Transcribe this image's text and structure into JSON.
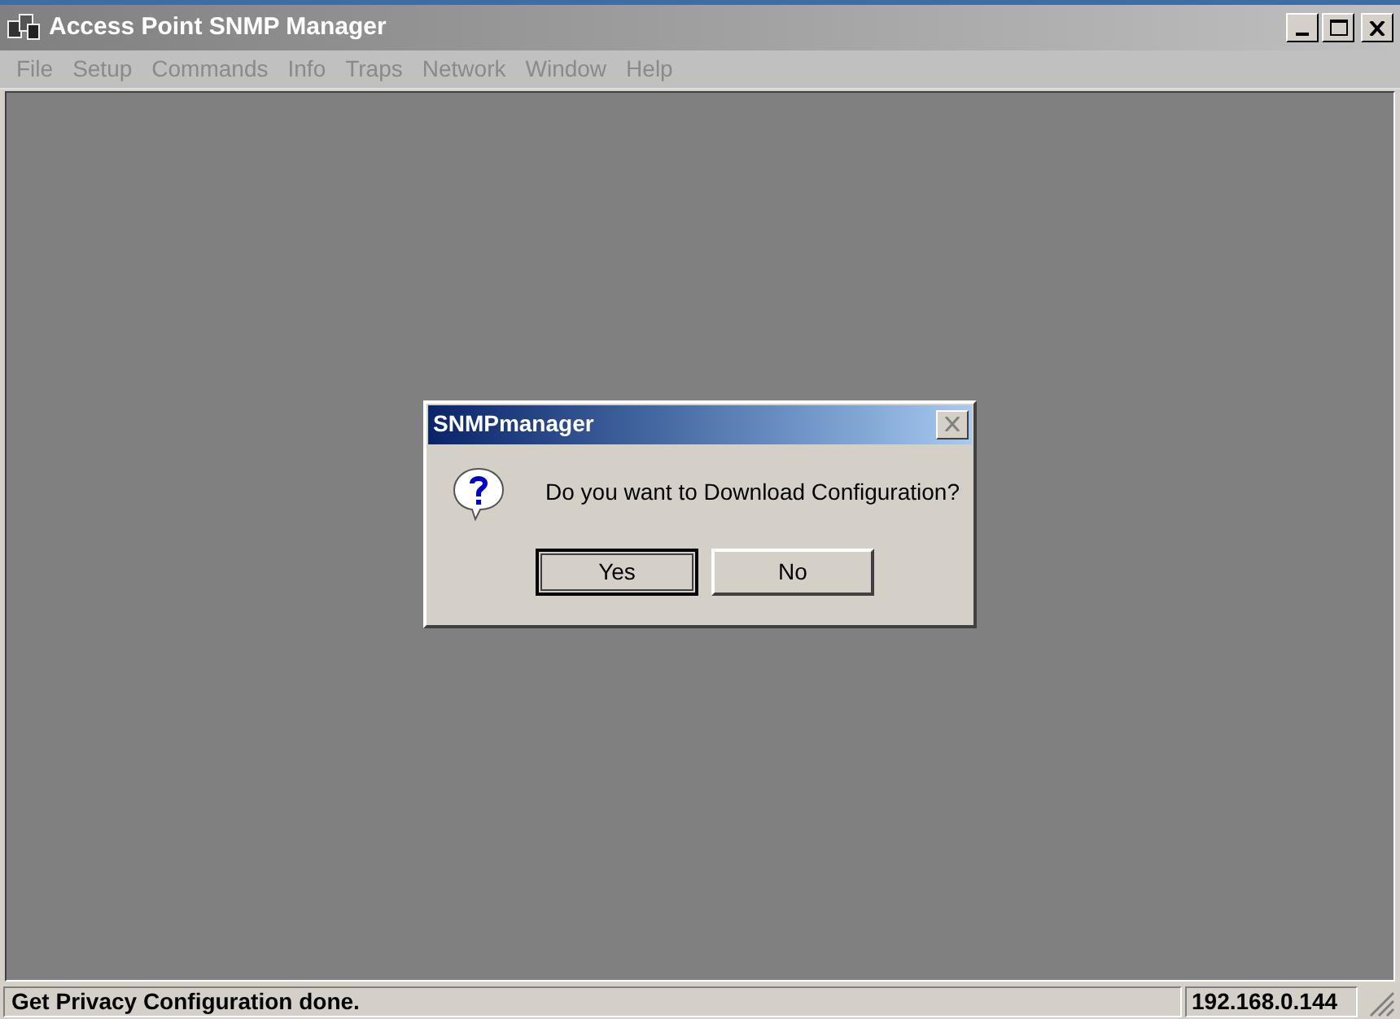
{
  "window": {
    "title": "Access Point SNMP Manager",
    "active": false
  },
  "menu": [
    {
      "label": "File",
      "disabled": true
    },
    {
      "label": "Setup",
      "disabled": true
    },
    {
      "label": "Commands",
      "disabled": true
    },
    {
      "label": "Info",
      "disabled": true
    },
    {
      "label": "Traps",
      "disabled": true
    },
    {
      "label": "Network",
      "disabled": true
    },
    {
      "label": "Window",
      "disabled": true
    },
    {
      "label": "Help",
      "disabled": true
    }
  ],
  "dialog": {
    "title": "SNMPmanager",
    "message": "Do you want to Download Configuration?",
    "buttons": [
      {
        "label": "Yes",
        "default": true
      },
      {
        "label": "No",
        "default": false
      }
    ]
  },
  "status_bar": {
    "message": "Get Privacy Configuration done.",
    "address": "192.168.0.144"
  }
}
